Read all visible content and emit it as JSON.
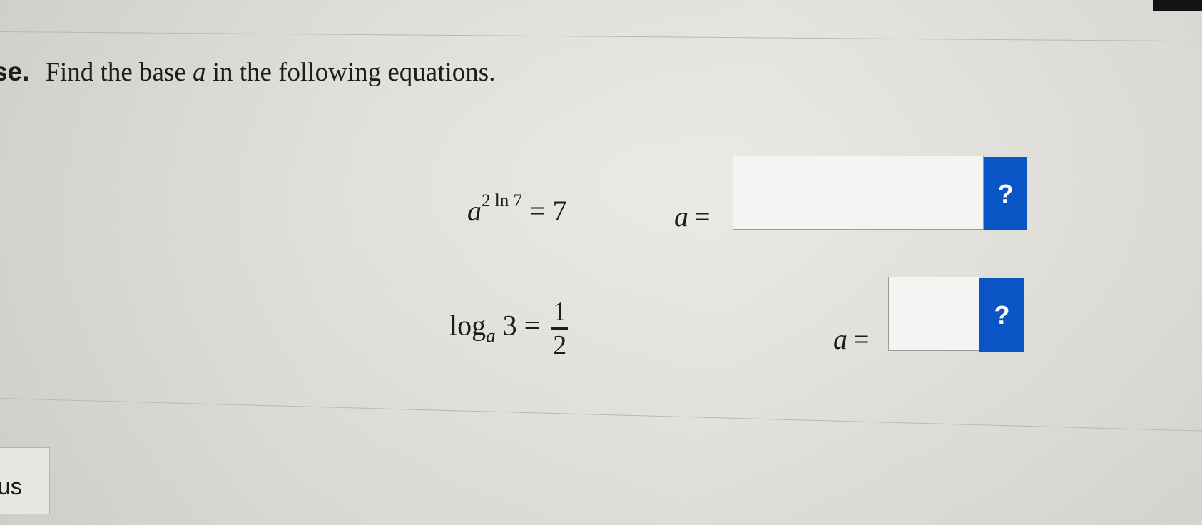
{
  "question": {
    "number": "se.",
    "text_before": "Find the base ",
    "variable": "a",
    "text_after": " in the following equations."
  },
  "equations": [
    {
      "base": "a",
      "exponent": "2 ln 7",
      "rhs": "= 7",
      "answer_label": "a",
      "answer_equals": "=",
      "answer_value": "",
      "help_label": "?"
    },
    {
      "log": "log",
      "log_base": "a",
      "argument": "3 =",
      "numerator": "1",
      "denominator": "2",
      "answer_label": "a",
      "answer_equals": "=",
      "answer_value": "",
      "help_label": "?"
    }
  ],
  "side_tab": {
    "label": "us"
  },
  "colors": {
    "help_button": "#0a55c6",
    "answer_box_bg": "#f4f4f2",
    "background": "#e2e1dc"
  }
}
